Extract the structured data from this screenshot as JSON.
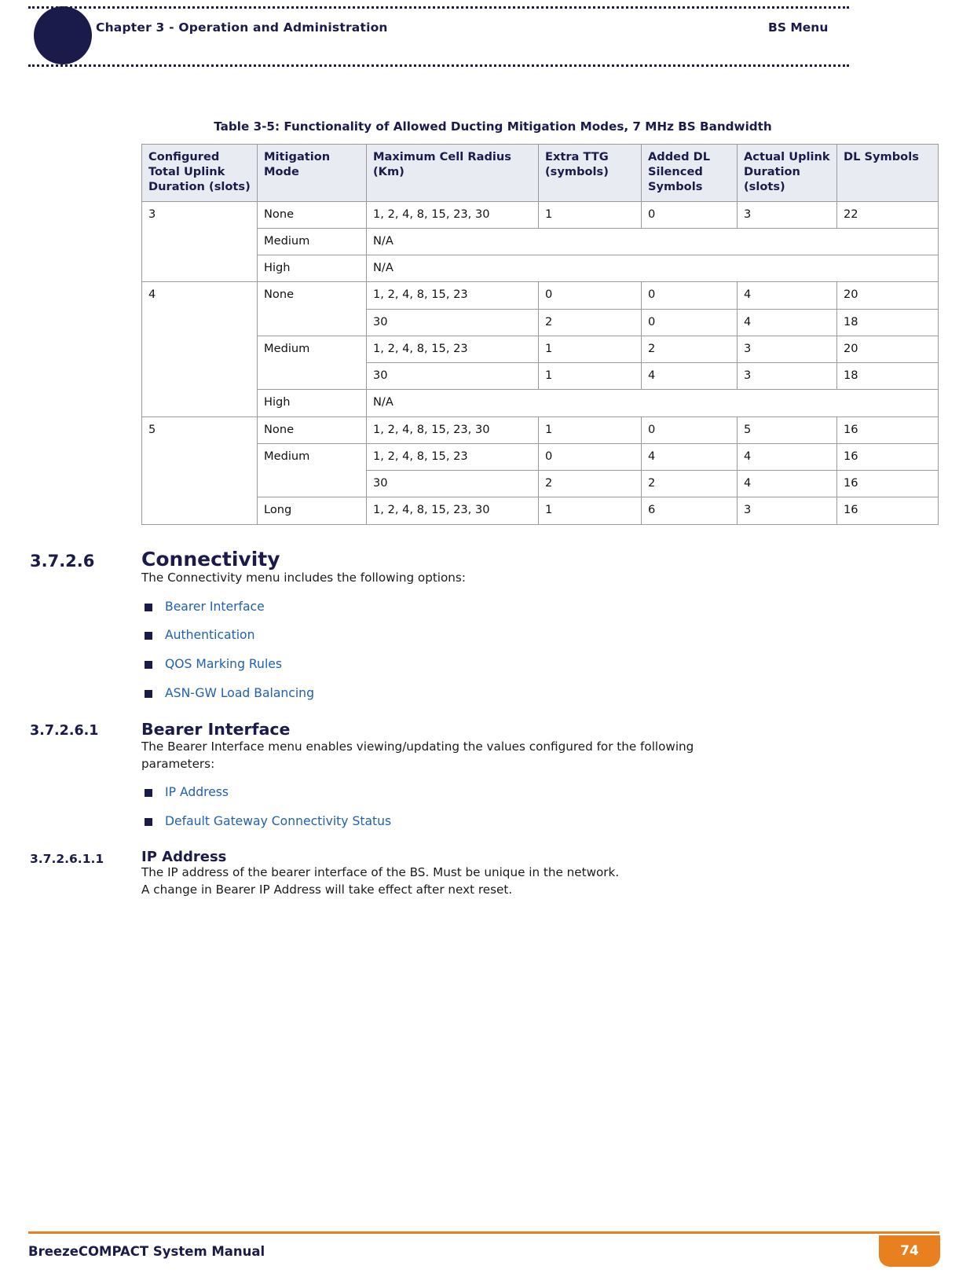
{
  "header": {
    "chapter": "Chapter 3 - Operation and Administration",
    "right_label": "BS Menu"
  },
  "table": {
    "caption": "Table 3-5: Functionality of Allowed Ducting Mitigation Modes, 7 MHz BS Bandwidth",
    "columns": [
      "Configured Total Uplink Duration (slots)",
      "Mitigation Mode",
      "Maximum Cell Radius (Km)",
      "Extra TTG (symbols)",
      "Added DL Silenced Symbols",
      "Actual Uplink Duration (slots)",
      "DL Symbols"
    ],
    "rows": [
      {
        "group": "3",
        "mode": "None",
        "radius": "1, 2, 4, 8, 15, 23, 30",
        "ttg": "1",
        "added": "0",
        "actual": "3",
        "dl": "22"
      },
      {
        "group": "",
        "mode": "Medium",
        "radius": "N/A",
        "na": true
      },
      {
        "group": "",
        "mode": "High",
        "radius": "N/A",
        "na": true
      },
      {
        "group": "4",
        "mode": "None",
        "radius": "1, 2, 4, 8, 15, 23",
        "ttg": "0",
        "added": "0",
        "actual": "4",
        "dl": "20"
      },
      {
        "group": "",
        "mode": "",
        "radius": "30",
        "ttg": "2",
        "added": "0",
        "actual": "4",
        "dl": "18"
      },
      {
        "group": "",
        "mode": "Medium",
        "radius": "1, 2, 4, 8, 15, 23",
        "ttg": "1",
        "added": "2",
        "actual": "3",
        "dl": "20"
      },
      {
        "group": "",
        "mode": "",
        "radius": "30",
        "ttg": "1",
        "added": "4",
        "actual": "3",
        "dl": "18"
      },
      {
        "group": "",
        "mode": "High",
        "radius": "N/A",
        "na": true
      },
      {
        "group": "5",
        "mode": "None",
        "radius": "1, 2, 4, 8, 15, 23, 30",
        "ttg": "1",
        "added": "0",
        "actual": "5",
        "dl": "16"
      },
      {
        "group": "",
        "mode": "Medium",
        "radius": "1, 2, 4, 8, 15, 23",
        "ttg": "0",
        "added": "4",
        "actual": "4",
        "dl": "16"
      },
      {
        "group": "",
        "mode": "",
        "radius": "30",
        "ttg": "2",
        "added": "2",
        "actual": "4",
        "dl": "16"
      },
      {
        "group": "",
        "mode": "Long",
        "radius": "1, 2, 4, 8, 15, 23, 30",
        "ttg": "1",
        "added": "6",
        "actual": "3",
        "dl": "16"
      }
    ]
  },
  "sections": {
    "connectivity": {
      "number": "3.7.2.6",
      "title": "Connectivity",
      "intro": "The Connectivity menu includes the following options:",
      "links": [
        "Bearer Interface",
        "Authentication",
        "QOS Marking Rules",
        "ASN-GW Load Balancing"
      ]
    },
    "bearer_interface": {
      "number": "3.7.2.6.1",
      "title": "Bearer Interface",
      "intro_line1": "The Bearer Interface menu enables viewing/updating the values configured for the following",
      "intro_line2": "parameters:",
      "links": [
        "IP Address",
        "Default Gateway Connectivity Status"
      ]
    },
    "ip_address": {
      "number": "3.7.2.6.1.1",
      "title": "IP Address",
      "para1": "The IP address of the bearer interface of the BS. Must be unique in the network.",
      "para2": "A change in Bearer IP Address will take effect after next reset."
    }
  },
  "footer": {
    "manual": "BreezeCOMPACT System Manual",
    "page": "74"
  }
}
